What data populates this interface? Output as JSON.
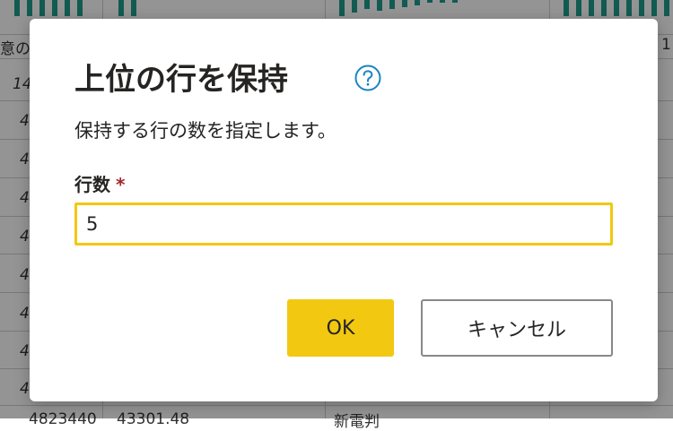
{
  "background": {
    "cells": [
      "意の",
      "14",
      "4",
      "4",
      "4",
      "4",
      "4",
      "4",
      "4",
      "4",
      "1",
      "4823440",
      "43301.48",
      "新電判"
    ]
  },
  "dialog": {
    "title": "上位の行を保持",
    "help_icon": "question-circle-icon",
    "description": "保持する行の数を指定します。",
    "field_label": "行数",
    "required_mark": "*",
    "row_count_value": "5",
    "ok_label": "OK",
    "cancel_label": "キャンセル"
  },
  "colors": {
    "accent": "#f2c811",
    "help_icon": "#1b84c2",
    "required": "#a4262c",
    "chart_bars": "#1f9e8d"
  }
}
